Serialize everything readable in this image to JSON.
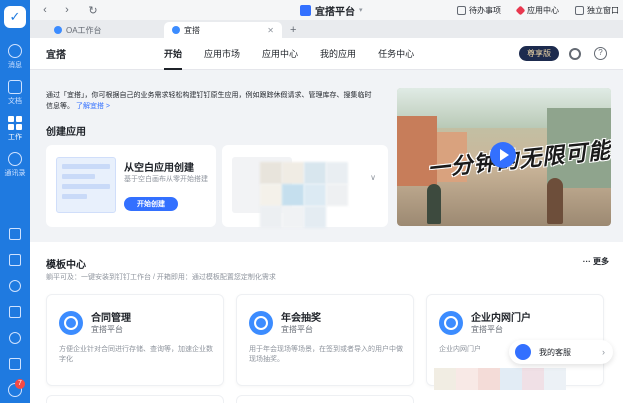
{
  "rail": {
    "logo": "✓",
    "nav": [
      {
        "label": "消息",
        "icon": "message-icon"
      },
      {
        "label": "文档",
        "icon": "doc-icon"
      },
      {
        "label": "工作",
        "icon": "grid-icon",
        "active": true
      },
      {
        "label": "通讯录",
        "icon": "contacts-icon"
      }
    ],
    "badge": "7"
  },
  "titlebar": {
    "back": "‹",
    "forward": "›",
    "refresh": "↻",
    "title": "宜搭平台",
    "caret": "▾",
    "todo": "待办事项",
    "appcenter": "应用中心",
    "standalone": "独立窗口"
  },
  "tabs": [
    {
      "label": "OA工作台",
      "close": "✕",
      "active": false
    },
    {
      "label": "宜搭",
      "close": "✕",
      "active": true
    }
  ],
  "tab_plus": "+",
  "header": {
    "brand": "宜搭",
    "menu": [
      "开始",
      "应用市场",
      "应用中心",
      "我的应用",
      "任务中心"
    ],
    "vip": "尊享版",
    "help": "?"
  },
  "intro": {
    "text": "通过「宜搭」，你可根据自己的业务需求轻松构建钉钉原生应用，例如跟踪休假请求、管理库存、搜集临时信息等。",
    "link": "了解宜搭 >"
  },
  "create": {
    "title": "创建应用",
    "blank_title": "从空白应用创建",
    "blank_desc": "基于空白画布从零开始搭建",
    "blank_button": "开始创建",
    "collapse": "∨"
  },
  "video": {
    "headline": "一分钟的无限可能"
  },
  "templates": {
    "title": "模板中心",
    "more": "··· 更多",
    "subtitle": "躺平可及：一键安装到钉钉工作台 / 开箱即用：通过模板配置您定制化需求",
    "cards": [
      {
        "name": "合同管理",
        "publisher": "宜搭平台",
        "desc": "方便企业针对合同进行存储、查询等，加速企业数字化"
      },
      {
        "name": "年会抽奖",
        "publisher": "宜搭平台",
        "desc": "用于年会现场等场景，在签到或者导入的用户中做现场抽奖。"
      },
      {
        "name": "企业内网门户",
        "publisher": "宜搭平台",
        "desc": "企业内网门户"
      }
    ]
  },
  "service": {
    "label": "我的客服",
    "chev": "›"
  }
}
